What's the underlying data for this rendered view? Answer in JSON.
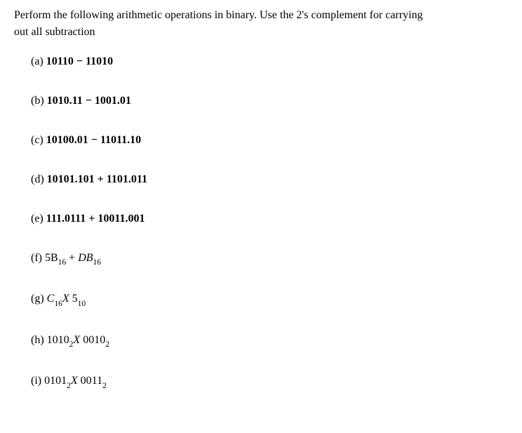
{
  "intro": {
    "line1": "Perform the following arithmetic operations in binary. Use the 2's complement for carrying",
    "line2": "out all subtraction"
  },
  "problems": {
    "a": {
      "label": "(a) ",
      "expr": "10110 − 11010"
    },
    "b": {
      "label": "(b) ",
      "expr": "1010.11 − 1001.01"
    },
    "c": {
      "label": "(c) ",
      "expr": "10100.01 − 11011.10"
    },
    "d": {
      "label": "(d) ",
      "expr": "10101.101 + 1101.011"
    },
    "e": {
      "label": "(e) ",
      "expr": "111.0111 + 10011.001"
    },
    "f": {
      "label": "(f) ",
      "t1": "5B",
      "s1": "16",
      "plus": " +  ",
      "t2": "DB",
      "s2": "16"
    },
    "g": {
      "label": "(g) ",
      "t1": "C",
      "s1": "16",
      "x": "X ",
      "t2": "5",
      "s2": "10"
    },
    "h": {
      "label": "(h) ",
      "t1": "1010",
      "s1": "2",
      "x": "X ",
      "t2": "0010",
      "s2": "2"
    },
    "i": {
      "label": "(i) ",
      "t1": "0101",
      "s1": "2",
      "x": "X ",
      "t2": "0011",
      "s2": "2"
    }
  }
}
